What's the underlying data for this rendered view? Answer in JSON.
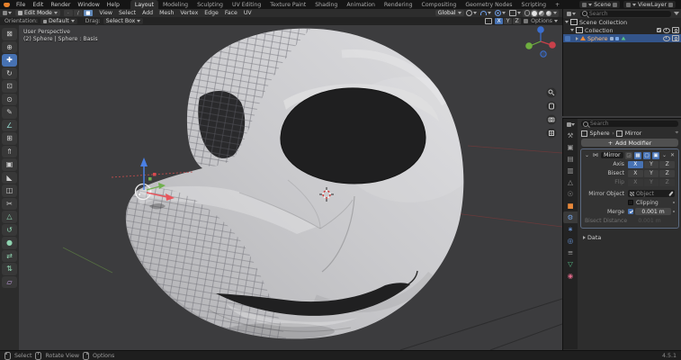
{
  "topbar": {
    "menus": [
      "File",
      "Edit",
      "Render",
      "Window",
      "Help"
    ],
    "workspaces": [
      "Layout",
      "Modeling",
      "Sculpting",
      "UV Editing",
      "Texture Paint",
      "Shading",
      "Animation",
      "Rendering",
      "Compositing",
      "Geometry Nodes",
      "Scripting"
    ],
    "active_workspace": "Layout",
    "new_workspace_label": "+",
    "scene_label": "Scene",
    "view_layer_label": "ViewLayer"
  },
  "viewport_header": {
    "mode": "Edit Mode",
    "menus": [
      "View",
      "Select",
      "Add",
      "Mesh",
      "Vertex",
      "Edge",
      "Face",
      "UV"
    ],
    "orientation": "Global",
    "options_label": "Options"
  },
  "tool_settings": {
    "orientation_label": "Orientation:",
    "orientation_value": "Default",
    "drag_label": "Drag:",
    "drag_value": "Select Box",
    "mirror_axes": [
      "X",
      "Y",
      "Z"
    ]
  },
  "viewport": {
    "view_label": "User Perspective",
    "object_label": "(2) Sphere | Sphere : Basis"
  },
  "toolbar": {
    "tools": [
      {
        "name": "select-box",
        "glyph": "⊠"
      },
      {
        "name": "cursor",
        "glyph": "⊕"
      },
      {
        "name": "move",
        "glyph": "✚"
      },
      {
        "name": "rotate",
        "glyph": "↻"
      },
      {
        "name": "scale",
        "glyph": "⊡"
      },
      {
        "name": "transform",
        "glyph": "⊙"
      },
      {
        "name": "annotate",
        "glyph": "✎"
      },
      {
        "name": "measure",
        "glyph": "∠"
      },
      {
        "name": "add-cube",
        "glyph": "⊞"
      },
      {
        "name": "extrude-region",
        "glyph": "⇑"
      },
      {
        "name": "inset-faces",
        "glyph": "▣"
      },
      {
        "name": "bevel",
        "glyph": "◣"
      },
      {
        "name": "loop-cut",
        "glyph": "◫"
      },
      {
        "name": "knife",
        "glyph": "✂"
      },
      {
        "name": "poly-build",
        "glyph": "△"
      },
      {
        "name": "spin",
        "glyph": "↺"
      },
      {
        "name": "smooth",
        "glyph": "●"
      },
      {
        "name": "edge-slide",
        "glyph": "⇄"
      },
      {
        "name": "shrink-fatten",
        "glyph": "⇅"
      },
      {
        "name": "shear",
        "glyph": "▱"
      }
    ]
  },
  "outliner": {
    "search_placeholder": "Search",
    "rows": [
      {
        "label": "Scene Collection"
      },
      {
        "label": "Collection"
      },
      {
        "label": "Sphere"
      }
    ]
  },
  "properties": {
    "search_placeholder": "Search",
    "breadcrumb": {
      "object": "Sphere",
      "separator": "›",
      "modifier": "Mirror"
    },
    "add_modifier_plus": "+",
    "add_modifier_label": "Add Modifier",
    "tabs": [
      {
        "name": "tool",
        "glyph": "⚒"
      },
      {
        "name": "render",
        "glyph": "▣"
      },
      {
        "name": "output",
        "glyph": "▤"
      },
      {
        "name": "view-layer",
        "glyph": "▥"
      },
      {
        "name": "scene",
        "glyph": "△"
      },
      {
        "name": "world",
        "glyph": "☉"
      },
      {
        "name": "object",
        "glyph": "■"
      },
      {
        "name": "modifiers",
        "glyph": "⚙"
      },
      {
        "name": "particles",
        "glyph": "∗"
      },
      {
        "name": "physics",
        "glyph": "◎"
      },
      {
        "name": "constraints",
        "glyph": "≡"
      },
      {
        "name": "data",
        "glyph": "▽"
      },
      {
        "name": "material",
        "glyph": "◉"
      }
    ],
    "modifier": {
      "expand_glyph": "⌄",
      "icon_glyph": "⋈",
      "name": "Mirror",
      "toggles": [
        {
          "name": "on-cage",
          "glyph": "◲"
        },
        {
          "name": "edit-mode",
          "glyph": "▦"
        },
        {
          "name": "realtime",
          "glyph": "▢"
        },
        {
          "name": "render",
          "glyph": "▣"
        }
      ],
      "extras_glyph": "⌄",
      "close_glyph": "✕",
      "labels": {
        "axis": "Axis",
        "bisect": "Bisect",
        "flip": "Flip",
        "mirror_object": "Mirror Object",
        "clipping": "Clipping",
        "merge": "Merge",
        "bisect_distance": "Bisect Distance"
      },
      "axes": [
        "X",
        "Y",
        "Z"
      ],
      "object_placeholder": "Object",
      "merge_value": "0.001 m",
      "bisect_distance_value": "0.001 m",
      "data_section": "Data"
    }
  },
  "statusbar": {
    "select": "Select",
    "rotate": "Rotate View",
    "options": "Options",
    "version": "4.5.1"
  },
  "colors": {
    "accent": "#4772b3",
    "selected_object_text": "#ffbe7a",
    "axis_red": "#c9404a",
    "axis_green": "#6fae3f",
    "axis_blue": "#3b6fd0"
  }
}
